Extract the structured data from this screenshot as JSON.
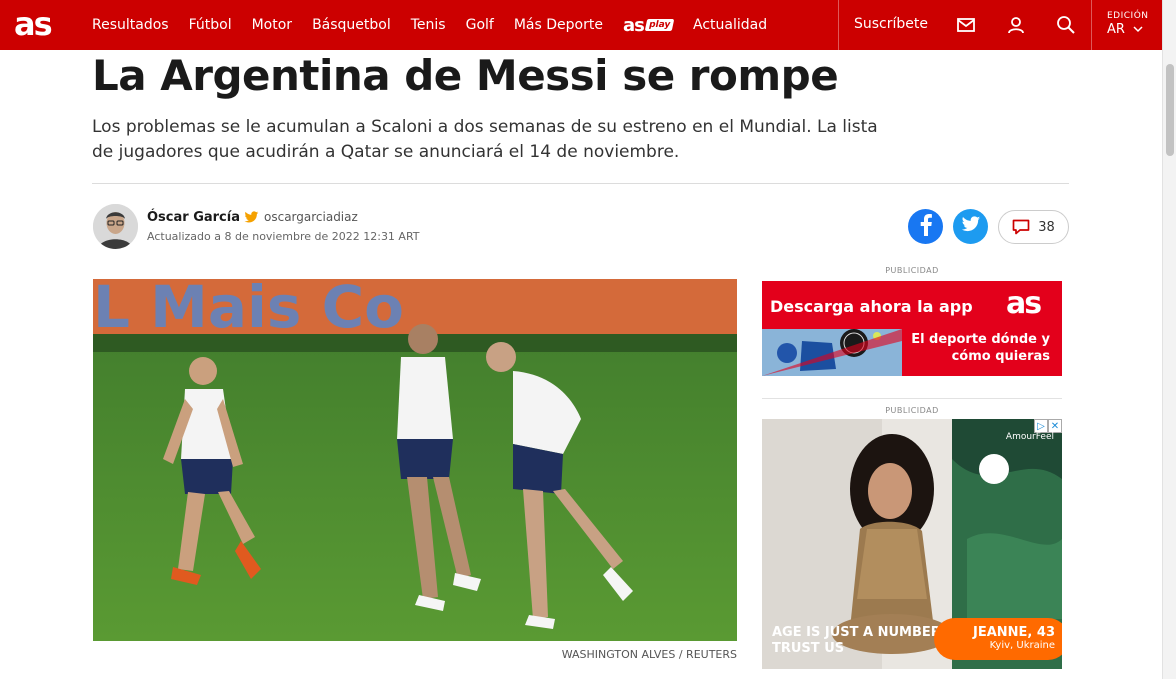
{
  "header": {
    "logo": "as",
    "nav": [
      "Resultados",
      "Fútbol",
      "Motor",
      "Básquetbol",
      "Tenis",
      "Golf",
      "Más Deporte"
    ],
    "asplay_logo": "as",
    "asplay_badge": "play",
    "nav_last": "Actualidad",
    "subscribe": "Suscríbete",
    "icons": [
      "mail-icon",
      "user-icon",
      "search-icon"
    ],
    "edition_label": "EDICIÓN",
    "edition_value": "AR"
  },
  "article": {
    "headline": "La Argentina de Messi se rompe",
    "subhead": "Los problemas se le acumulan a Scaloni a dos semanas de su estreno en el Mundial. La lista de jugadores que acudirán a Qatar se anunciará el 14 de noviembre.",
    "author": "Óscar García",
    "twitter": "oscargarciadiaz",
    "updated": "Actualizado a 8 de noviembre de 2022 12:31 ART",
    "comments_count": "38",
    "photo_caption": "WASHINGTON ALVES / REUTERS",
    "photo_banner_text": "L Mais Co"
  },
  "ads": {
    "label": "PUBLICIDAD",
    "ad1_title": "Descarga ahora la app",
    "ad1_logo": "as",
    "ad1_line1": "El deporte dónde y",
    "ad1_line2": "cómo quieras",
    "ad2_brand": "AmourFeel",
    "ad2_tag1": "AGE IS JUST A NUMBER,",
    "ad2_tag2": "TRUST US",
    "ad2_name": "JEANNE, 43",
    "ad2_city": "Kyiv, Ukraine"
  },
  "colors": {
    "brand_red": "#cc0000",
    "facebook": "#1877f2",
    "twitter": "#1d9bf0",
    "ad_orange": "#ff6a00"
  }
}
